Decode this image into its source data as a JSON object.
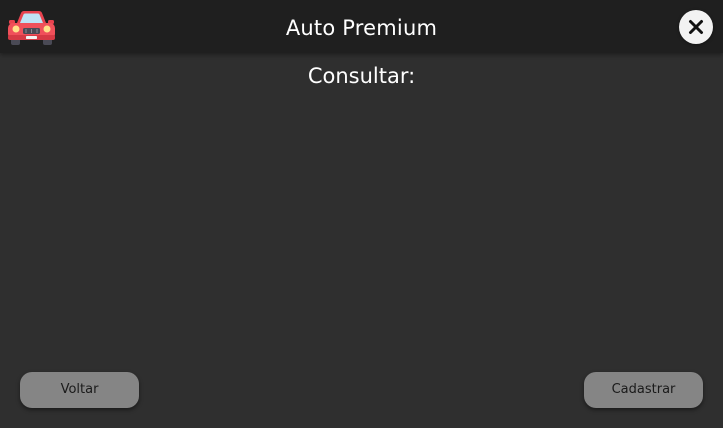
{
  "header": {
    "app_title": "Auto Premium",
    "logo_icon": "car-icon",
    "close_icon": "close-icon"
  },
  "main": {
    "heading": "Consultar:"
  },
  "footer": {
    "back_label": "Voltar",
    "register_label": "Cadastrar"
  },
  "colors": {
    "background": "#2f2f2f",
    "titlebar": "#1f1f1f",
    "button": "#858585",
    "car_body": "#f0505a"
  }
}
